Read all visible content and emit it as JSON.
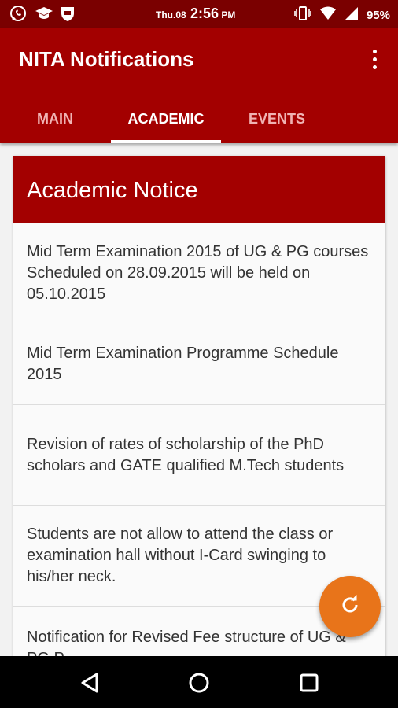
{
  "status_bar": {
    "day": "Thu.08",
    "time": "2:56",
    "ampm": "PM",
    "battery": "95%",
    "icons_left": [
      "whatsapp-icon",
      "graduation-cap-icon",
      "shield-icon"
    ],
    "icons_right": [
      "vibrate-icon",
      "wifi-icon",
      "signal-icon"
    ]
  },
  "app_bar": {
    "title": "NITA Notifications",
    "color": "#a30000"
  },
  "tabs": [
    {
      "label": "MAIN",
      "active": false
    },
    {
      "label": "ACADEMIC",
      "active": true
    },
    {
      "label": "EVENTS",
      "active": false
    }
  ],
  "card": {
    "header": "Academic Notice",
    "notices": [
      "Mid Term Examination 2015 of UG & PG courses Scheduled on 28.09.2015 will be held on 05.10.2015",
      "Mid Term Examination Programme Schedule 2015",
      "Revision of rates of scholarship of the PhD scholars and GATE qualified M.Tech students",
      "Students are not allow to attend the class or examination hall without I-Card swinging to his/her neck.",
      "Notification for Revised Fee structure of UG & PG P..."
    ]
  },
  "fab": {
    "icon": "refresh-icon",
    "color": "#e8741a"
  },
  "nav_bar": {
    "buttons": [
      "back-icon",
      "home-icon",
      "recents-icon"
    ]
  }
}
